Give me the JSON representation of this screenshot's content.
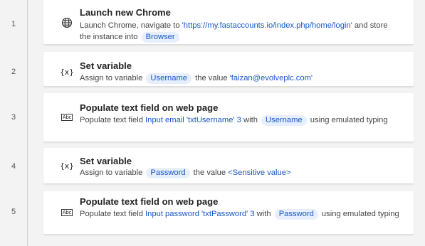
{
  "steps": [
    {
      "num": "1",
      "icon": "globe-icon",
      "title": "Launch new Chrome",
      "desc": {
        "t1": "Launch Chrome, navigate to ",
        "url": "'https://my.fastaccounts.io/index.php/home/login'",
        "t2": " and store the instance into ",
        "var": "Browser"
      }
    },
    {
      "num": "2",
      "icon": "variable-icon",
      "icon_text": "{x}",
      "title": "Set variable",
      "desc": {
        "t1": "Assign to variable ",
        "var": "Username",
        "t2": " the value ",
        "value": "'faizan@evolveplc.com'"
      }
    },
    {
      "num": "3",
      "icon": "text-field-icon",
      "icon_text": "Abc",
      "title": "Populate text field on web page",
      "desc": {
        "t1": "Populate text field ",
        "element": "Input email 'txtUsername' 3",
        "t2": " with ",
        "var": "Username",
        "t3": " using emulated typing"
      }
    },
    {
      "num": "4",
      "icon": "variable-icon",
      "icon_text": "{x}",
      "title": "Set variable",
      "desc": {
        "t1": "Assign to variable ",
        "var": "Password",
        "t2": " the value ",
        "value": "<Sensitive value>"
      }
    },
    {
      "num": "5",
      "icon": "text-field-icon",
      "icon_text": "Abc",
      "title": "Populate text field on web page",
      "desc": {
        "t1": "Populate text field ",
        "element": "Input password 'txtPassword' 3",
        "t2": " with ",
        "var": "Password",
        "t3": " using emulated typing"
      }
    }
  ]
}
